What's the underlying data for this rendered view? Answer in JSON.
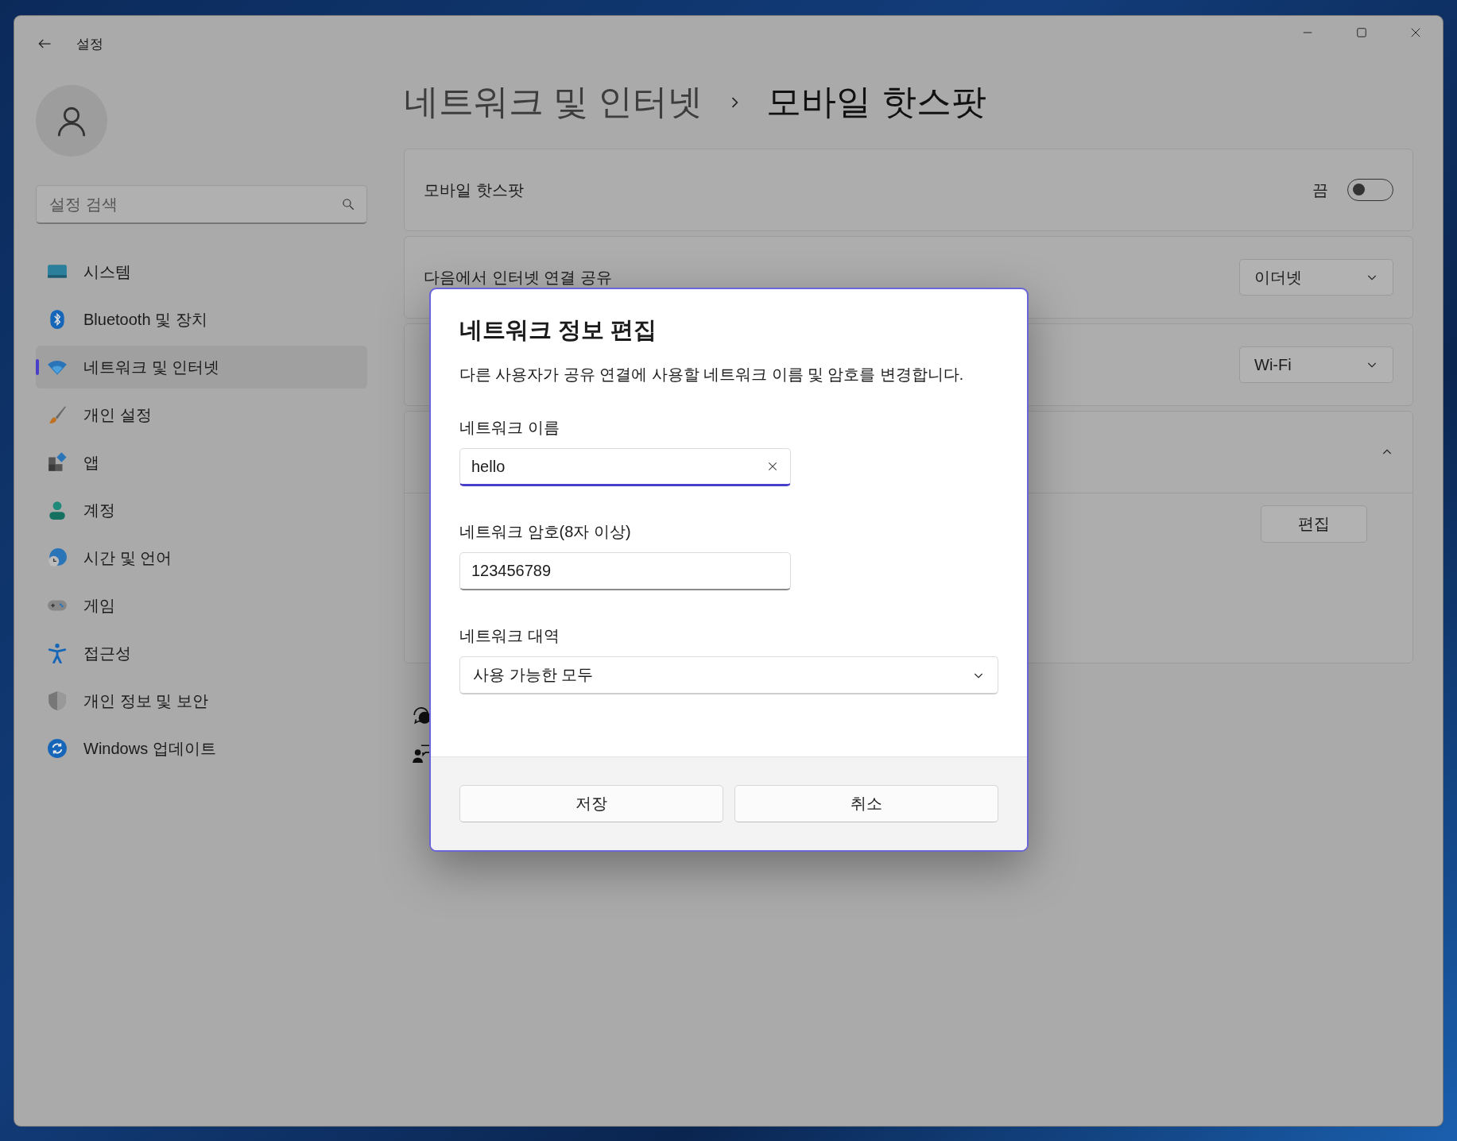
{
  "window": {
    "title": "설정"
  },
  "search": {
    "placeholder": "설정 검색"
  },
  "nav": [
    {
      "kind": "system",
      "label": "시스템",
      "selected": false
    },
    {
      "kind": "bluetooth",
      "label": "Bluetooth 및 장치",
      "selected": false
    },
    {
      "kind": "network",
      "label": "네트워크 및 인터넷",
      "selected": true
    },
    {
      "kind": "personalize",
      "label": "개인 설정",
      "selected": false
    },
    {
      "kind": "apps",
      "label": "앱",
      "selected": false
    },
    {
      "kind": "account",
      "label": "계정",
      "selected": false
    },
    {
      "kind": "time",
      "label": "시간 및 언어",
      "selected": false
    },
    {
      "kind": "game",
      "label": "게임",
      "selected": false
    },
    {
      "kind": "access",
      "label": "접근성",
      "selected": false
    },
    {
      "kind": "privacy",
      "label": "개인 정보 및 보안",
      "selected": false
    },
    {
      "kind": "update",
      "label": "Windows 업데이트",
      "selected": false
    }
  ],
  "breadcrumb": [
    "네트워크 및 인터넷",
    "모바일 핫스팟"
  ],
  "settings": [
    {
      "kind": "toggle",
      "label": "모바일 핫스팟",
      "state_text": "끔",
      "on": false
    },
    {
      "kind": "dropdown",
      "label": "다음에서 인터넷 연결 공유",
      "value": "이더넷"
    },
    {
      "kind": "dropdown",
      "value": "Wi-Fi"
    },
    {
      "kind": "expander",
      "expanded": true,
      "button": "편집"
    }
  ],
  "dialog": {
    "title": "네트워크 정보 편집",
    "description": "다른 사용자가 공유 연결에 사용할 네트워크 이름 및 암호를 변경합니다.",
    "fields": [
      {
        "kind": "text",
        "label": "네트워크 이름",
        "value": "hello",
        "focused": true
      },
      {
        "kind": "text",
        "label": "네트워크 암호(8자 이상)",
        "value": "123456789",
        "focused": false
      },
      {
        "kind": "select",
        "label": "네트워크 대역",
        "value": "사용 가능한 모두"
      }
    ],
    "buttons": [
      "저장",
      "취소"
    ]
  }
}
